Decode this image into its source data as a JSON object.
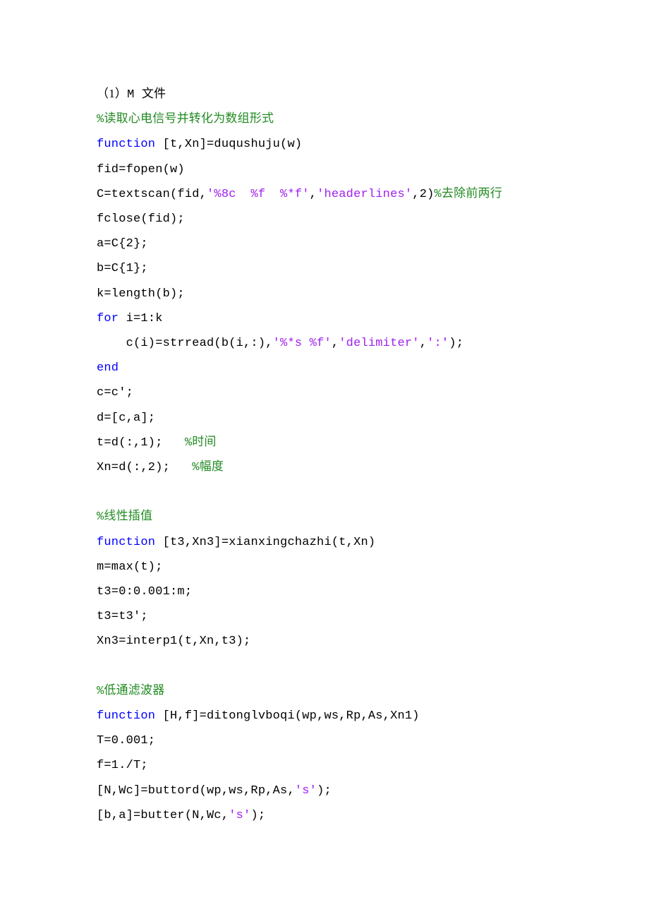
{
  "lines": [
    {
      "segments": [
        {
          "text": "（1）",
          "cls": "cnpunct"
        },
        {
          "text": "M ",
          "cls": ""
        },
        {
          "text": "文件",
          "cls": "cnpunct"
        }
      ]
    },
    {
      "segments": [
        {
          "text": "%读取心电信号并转化为数组形式",
          "cls": "cm"
        }
      ]
    },
    {
      "segments": [
        {
          "text": "function ",
          "cls": "kw"
        },
        {
          "text": "[t,Xn]=duqushuju(w)",
          "cls": ""
        }
      ]
    },
    {
      "segments": [
        {
          "text": "fid=fopen(w)",
          "cls": ""
        }
      ]
    },
    {
      "segments": [
        {
          "text": "C=textscan(fid,",
          "cls": ""
        },
        {
          "text": "'%8c  %f  %*f'",
          "cls": "st"
        },
        {
          "text": ",",
          "cls": ""
        },
        {
          "text": "'headerlines'",
          "cls": "st"
        },
        {
          "text": ",2)",
          "cls": ""
        },
        {
          "text": "%去除前两行",
          "cls": "cm"
        }
      ]
    },
    {
      "segments": [
        {
          "text": "fclose(fid);",
          "cls": ""
        }
      ]
    },
    {
      "segments": [
        {
          "text": "a=C{2};",
          "cls": ""
        }
      ]
    },
    {
      "segments": [
        {
          "text": "b=C{1};",
          "cls": ""
        }
      ]
    },
    {
      "segments": [
        {
          "text": "k=length(b);",
          "cls": ""
        }
      ]
    },
    {
      "segments": [
        {
          "text": "for ",
          "cls": "kw"
        },
        {
          "text": "i=1:k",
          "cls": ""
        }
      ]
    },
    {
      "segments": [
        {
          "text": "    c(i)=strread(b(i,:),",
          "cls": ""
        },
        {
          "text": "'%*s %f'",
          "cls": "st"
        },
        {
          "text": ",",
          "cls": ""
        },
        {
          "text": "'delimiter'",
          "cls": "st"
        },
        {
          "text": ",",
          "cls": ""
        },
        {
          "text": "':'",
          "cls": "st"
        },
        {
          "text": ");",
          "cls": ""
        }
      ]
    },
    {
      "segments": [
        {
          "text": "end",
          "cls": "kw"
        }
      ]
    },
    {
      "segments": [
        {
          "text": "c=c';",
          "cls": ""
        }
      ]
    },
    {
      "segments": [
        {
          "text": "d=[c,a];",
          "cls": ""
        }
      ]
    },
    {
      "segments": [
        {
          "text": "t=d(:,1);   ",
          "cls": ""
        },
        {
          "text": "%时间",
          "cls": "cm"
        }
      ]
    },
    {
      "segments": [
        {
          "text": "Xn=d(:,2);   ",
          "cls": ""
        },
        {
          "text": "%幅度",
          "cls": "cm"
        }
      ]
    },
    {
      "blank": true
    },
    {
      "segments": [
        {
          "text": "%线性插值",
          "cls": "cm"
        }
      ]
    },
    {
      "segments": [
        {
          "text": "function ",
          "cls": "kw"
        },
        {
          "text": "[t3,Xn3]=xianxingchazhi(t,Xn)",
          "cls": ""
        }
      ]
    },
    {
      "segments": [
        {
          "text": "m=max(t);",
          "cls": ""
        }
      ]
    },
    {
      "segments": [
        {
          "text": "t3=0:0.001:m;",
          "cls": ""
        }
      ]
    },
    {
      "segments": [
        {
          "text": "t3=t3';",
          "cls": ""
        }
      ]
    },
    {
      "segments": [
        {
          "text": "Xn3=interp1(t,Xn,t3);",
          "cls": ""
        }
      ]
    },
    {
      "blank": true
    },
    {
      "segments": [
        {
          "text": "%低通滤波器",
          "cls": "cm"
        }
      ]
    },
    {
      "segments": [
        {
          "text": "function ",
          "cls": "kw"
        },
        {
          "text": "[H,f]=ditonglvboqi(wp,ws,Rp,As,Xn1)",
          "cls": ""
        }
      ]
    },
    {
      "segments": [
        {
          "text": "T=0.001;",
          "cls": ""
        }
      ]
    },
    {
      "segments": [
        {
          "text": "f=1./T;",
          "cls": ""
        }
      ]
    },
    {
      "segments": [
        {
          "text": "[N,Wc]=buttord(wp,ws,Rp,As,",
          "cls": ""
        },
        {
          "text": "'s'",
          "cls": "st"
        },
        {
          "text": ");",
          "cls": ""
        }
      ]
    },
    {
      "segments": [
        {
          "text": "[b,a]=butter(N,Wc,",
          "cls": ""
        },
        {
          "text": "'s'",
          "cls": "st"
        },
        {
          "text": ");",
          "cls": ""
        }
      ]
    }
  ]
}
